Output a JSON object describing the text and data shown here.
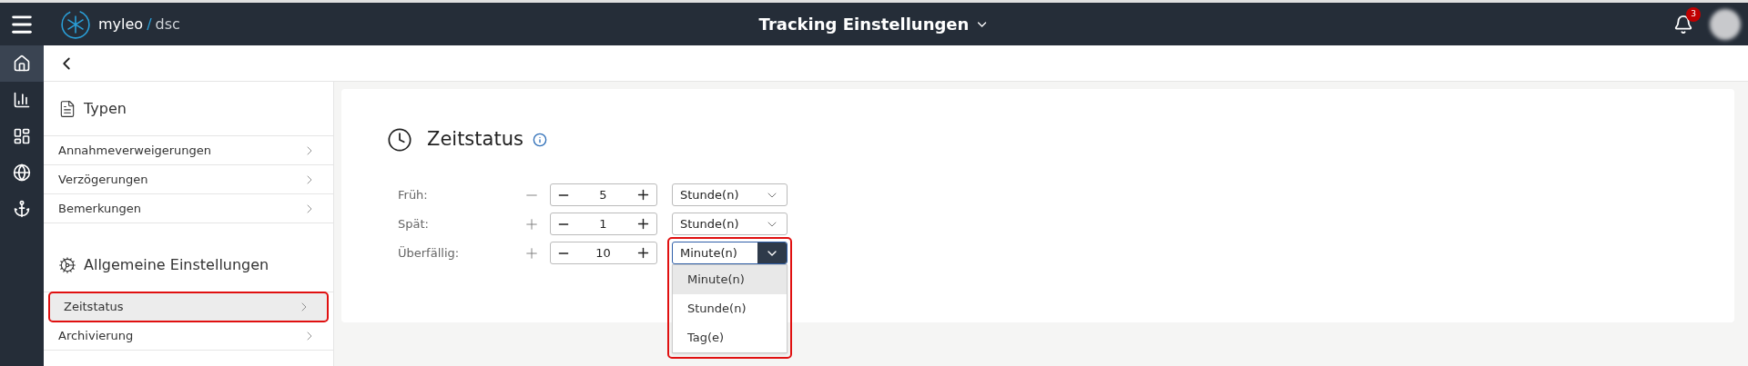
{
  "header": {
    "logo_name": "myleo",
    "logo_separator": "/",
    "logo_suffix": "dsc",
    "title": "Tracking Einstellungen",
    "notifications": "3"
  },
  "rail": [
    {
      "kind": "home",
      "selected": true
    },
    {
      "kind": "chart",
      "selected": false
    },
    {
      "kind": "dashboard",
      "selected": false
    },
    {
      "kind": "globe",
      "selected": false
    },
    {
      "kind": "anchor",
      "selected": false
    }
  ],
  "sidebar": {
    "sections": [
      {
        "title": "Typen",
        "kind": "document",
        "items": [
          {
            "label": "Annahmeverweigerungen",
            "selected": false,
            "highlighted": false
          },
          {
            "label": "Verzögerungen",
            "selected": false,
            "highlighted": false
          },
          {
            "label": "Bemerkungen",
            "selected": false,
            "highlighted": false
          }
        ]
      },
      {
        "title": "Allgemeine Einstellungen",
        "kind": "gears",
        "items": [
          {
            "label": "Zeitstatus",
            "selected": true,
            "highlighted": true
          },
          {
            "label": "Archivierung",
            "selected": false,
            "highlighted": false
          }
        ]
      }
    ]
  },
  "card": {
    "title": "Zeitstatus",
    "rows": [
      {
        "label": "Früh:",
        "negative": true,
        "value": "5",
        "unit": "Stunde(n)",
        "open": false
      },
      {
        "label": "Spät:",
        "negative": false,
        "value": "1",
        "unit": "Stunde(n)",
        "open": false
      },
      {
        "label": "Überfällig:",
        "negative": false,
        "value": "10",
        "unit": "Minute(n)",
        "open": true,
        "highlighted": true,
        "options": [
          {
            "label": "Minute(n)",
            "selected": true
          },
          {
            "label": "Stunde(n)",
            "selected": false
          },
          {
            "label": "Tag(e)",
            "selected": false
          }
        ]
      }
    ]
  }
}
